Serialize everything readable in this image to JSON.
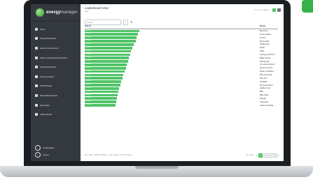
{
  "app": {
    "logo_bold": "energy",
    "logo_light": "manager"
  },
  "header": {
    "title": "Leaderboard View",
    "breadcrumb": "Data",
    "pager_text": "< 1 / 1 / 1 / 50 / 1 >"
  },
  "sidebar": {
    "items": [
      {
        "label": "Home",
        "icon": "home-icon"
      },
      {
        "label": "Energy Dashboard",
        "icon": "gauge-icon"
      },
      {
        "label": "Energy Consumption",
        "icon": "bolt-icon"
      },
      {
        "label": "Phase Consumption/Production",
        "icon": "phase-icon"
      },
      {
        "label": "Energy Monitoring",
        "icon": "chart-icon"
      },
      {
        "label": "Energy Analysis",
        "icon": "analysis-icon"
      },
      {
        "label": "Tariff Analysis",
        "icon": "tariff-icon"
      },
      {
        "label": "Renewable Analysis",
        "icon": "leaf-icon"
      },
      {
        "label": "Heat Maps",
        "icon": "grid-icon"
      },
      {
        "label": "Leader Board",
        "icon": "trophy-icon"
      }
    ],
    "bottom": [
      {
        "label": "Configuration",
        "icon": "gear-icon"
      },
      {
        "label": "Logout",
        "icon": "logout-icon"
      }
    ]
  },
  "search": {
    "placeholder": "Search"
  },
  "table": {
    "col_id": "Site Id",
    "col_name": "Name",
    "rows": [
      {
        "id": "1234567",
        "name": "Red Lion",
        "value": 100
      },
      {
        "id": "1234567",
        "name": "King's Head",
        "value": 97
      },
      {
        "id": "1234567",
        "name": "Crown",
        "value": 95
      },
      {
        "id": "1234567",
        "name": "Royal Oak",
        "value": 93
      },
      {
        "id": "1234567",
        "name": "White Hart",
        "value": 90
      },
      {
        "id": "1234567",
        "name": "Swan",
        "value": 87
      },
      {
        "id": "1234567",
        "name": "Ship",
        "value": 85
      },
      {
        "id": "1234567",
        "name": "George and Dra...",
        "value": 83
      },
      {
        "id": "1234567",
        "name": "Black Horse",
        "value": 81
      },
      {
        "id": "1234567",
        "name": "Rising Sun",
        "value": 79
      },
      {
        "id": "1234567",
        "name": "Fox and Hounds",
        "value": 77
      },
      {
        "id": "1234567",
        "name": "Queen's Arms",
        "value": 75
      },
      {
        "id": "1234567",
        "name": "Duke of Wellng...",
        "value": 73
      },
      {
        "id": "1234567",
        "name": "Bull and Gate",
        "value": 71
      },
      {
        "id": "1234567",
        "name": "Star Inn",
        "value": 69
      },
      {
        "id": "1234567",
        "name": "Old Bell",
        "value": 67
      },
      {
        "id": "1234567",
        "name": "Dog and Duck",
        "value": 65
      },
      {
        "id": "1234567",
        "name": "Golden Lion",
        "value": 63
      },
      {
        "id": "1234567",
        "name": "Bell",
        "value": 61
      },
      {
        "id": "1234567",
        "name": "Blue Boar",
        "value": 60
      },
      {
        "id": "1234567",
        "name": "Plough",
        "value": 59
      },
      {
        "id": "1234567",
        "name": "Chequers",
        "value": 58
      },
      {
        "id": "1234567",
        "name": "Lamb and Flag",
        "value": 57
      }
    ]
  },
  "footer": {
    "summary": "Min. Value: 3566.33 kWh/m² - Max. Value: 12773.3 kWh/m²",
    "per_page": "20 / page",
    "pages": [
      "1",
      "2",
      "3",
      "4"
    ],
    "active_page": "1",
    "prev": "<",
    "next": ">"
  },
  "colors": {
    "brand_green": "#4fc466",
    "sidebar_bg": "#34393f"
  }
}
